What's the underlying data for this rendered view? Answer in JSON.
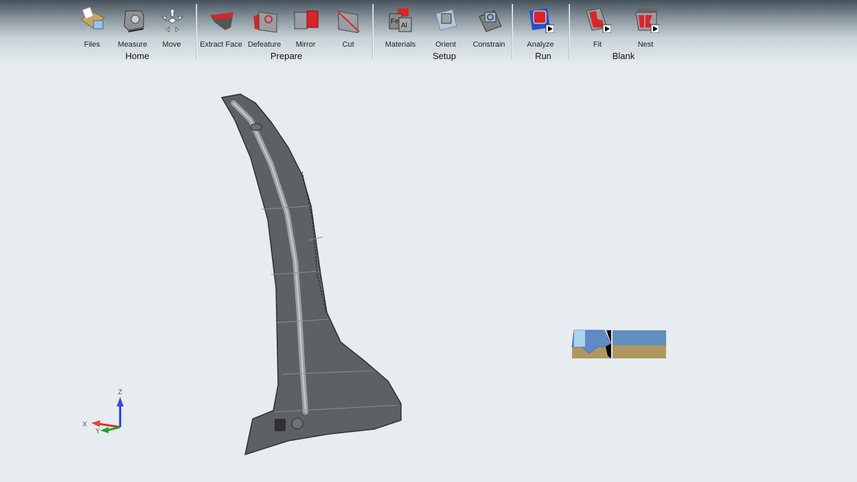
{
  "toolbar": {
    "groups": [
      {
        "title": "Home",
        "buttons": [
          {
            "label": "Files",
            "icon": "folder-files-icon"
          },
          {
            "label": "Measure",
            "icon": "measure-icon"
          },
          {
            "label": "Move",
            "icon": "move-arrows-icon"
          }
        ]
      },
      {
        "title": "Prepare",
        "buttons": [
          {
            "label": "Extract Face",
            "icon": "extract-face-icon"
          },
          {
            "label": "Defeature",
            "icon": "defeature-icon"
          },
          {
            "label": "Mirror",
            "icon": "mirror-icon"
          },
          {
            "label": "Cut",
            "icon": "cut-icon"
          }
        ]
      },
      {
        "title": "Setup",
        "buttons": [
          {
            "label": "Materials",
            "icon": "materials-icon"
          },
          {
            "label": "Orient",
            "icon": "orient-icon"
          },
          {
            "label": "Constrain",
            "icon": "constrain-icon"
          }
        ]
      },
      {
        "title": "Run",
        "buttons": [
          {
            "label": "Analyze",
            "icon": "analyze-icon"
          }
        ]
      },
      {
        "title": "Blank",
        "buttons": [
          {
            "label": "Fit",
            "icon": "blank-fit-icon"
          },
          {
            "label": "Nest",
            "icon": "blank-nest-icon"
          }
        ]
      }
    ]
  },
  "triad": {
    "x": "X",
    "y": "Y",
    "z": "Z"
  },
  "colors": {
    "accent_red": "#d8252a",
    "part_gray": "#5d6064",
    "background": "#e6ecef"
  }
}
